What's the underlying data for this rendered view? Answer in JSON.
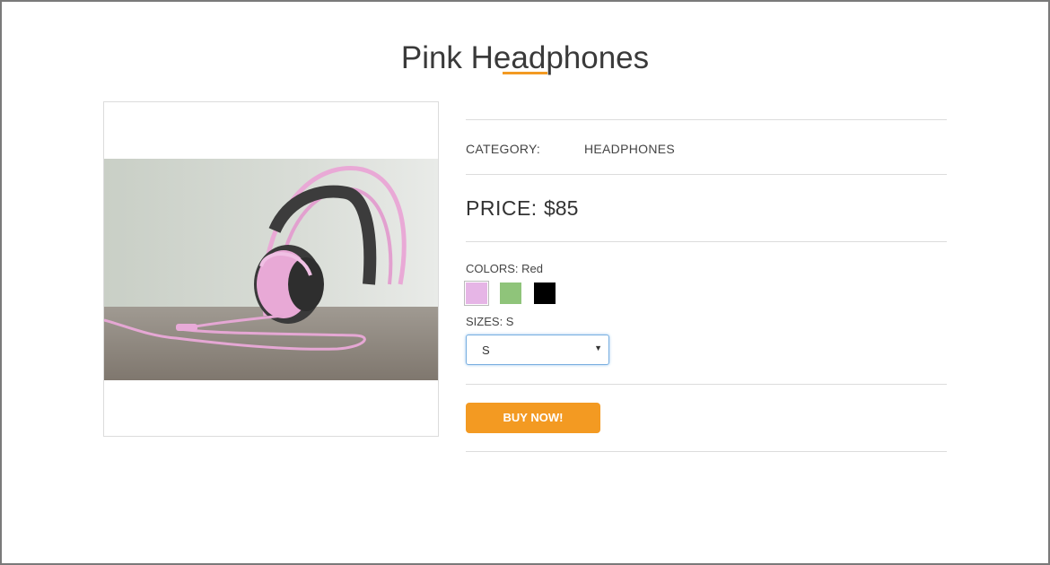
{
  "product": {
    "title": "Pink Headphones",
    "image_alt": "pink headphones on table",
    "category_label": "CATEGORY:",
    "category_value": "HEADPHONES",
    "price_label": "PRICE:",
    "price_value": "$85",
    "colors_label": "COLORS: Red",
    "colors": [
      {
        "name": "pink",
        "hex": "#e6b5e6",
        "selected": true
      },
      {
        "name": "green",
        "hex": "#8fc47a",
        "selected": false
      },
      {
        "name": "black",
        "hex": "#000000",
        "selected": false
      }
    ],
    "sizes_label": "SIZES: S",
    "size_selected": "S",
    "buy_label": "BUY NOW!"
  },
  "theme": {
    "accent": "#f39a22",
    "focus_border": "#78aee0"
  }
}
